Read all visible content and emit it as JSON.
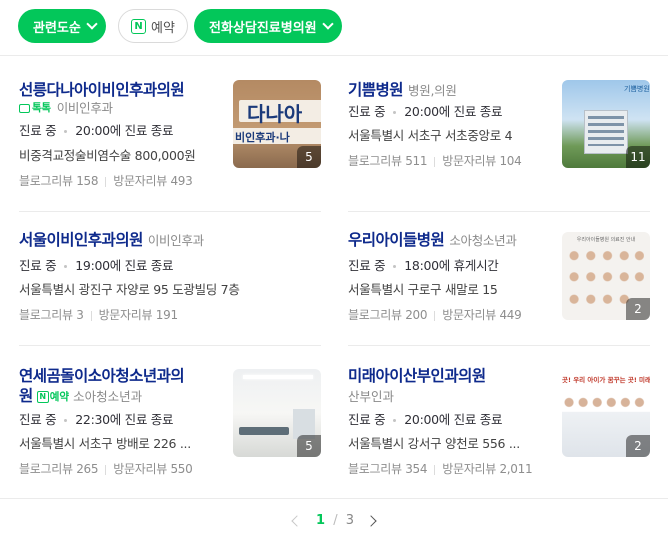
{
  "filters": {
    "related_label": "관련도순",
    "reserve_label": "예약",
    "phone_label": "전화상담진료병의원"
  },
  "places": [
    {
      "name": "선릉다나아이비인후과의원",
      "category": "이비인후과",
      "badge": "톡톡",
      "status": "진료 중",
      "hours": "20:00에 진료 종료",
      "extra": "비중격교정술비염수술 800,000원",
      "blog_label": "블로그리뷰",
      "blog_count": "158",
      "visit_label": "방문자리뷰",
      "visit_count": "493",
      "photo_count": "5",
      "photo_text": "다나아 | 비인후과·나"
    },
    {
      "name": "기쁨병원",
      "category": "병원,의원",
      "status": "진료 중",
      "hours": "20:00에 진료 종료",
      "extra": "서울특별시 서초구 서초중앙로 4",
      "blog_label": "블로그리뷰",
      "blog_count": "511",
      "visit_label": "방문자리뷰",
      "visit_count": "104",
      "photo_count": "11",
      "photo_text": "기쁨병원"
    },
    {
      "name": "서울이비인후과의원",
      "category": "이비인후과",
      "status": "진료 중",
      "hours": "19:00에 진료 종료",
      "extra": "서울특별시 광진구 자양로 95 도광빌딩 7층",
      "blog_label": "블로그리뷰",
      "blog_count": "3",
      "visit_label": "방문자리뷰",
      "visit_count": "191"
    },
    {
      "name": "우리아이들병원",
      "category": "소아청소년과",
      "status": "진료 중",
      "hours": "18:00에 휴게시간",
      "extra": "서울특별시 구로구 새말로 15",
      "blog_label": "블로그리뷰",
      "blog_count": "200",
      "visit_label": "방문자리뷰",
      "visit_count": "449",
      "photo_count": "2",
      "photo_text": "우리아이들병원 의료진 안내"
    },
    {
      "name": "연세곰돌이소아청소년과의원",
      "name_line1": "연세곰돌이소아청소년과의",
      "name_line2": "원",
      "badge": "예약",
      "category": "소아청소년과",
      "status": "진료 중",
      "hours": "22:30에 진료 종료",
      "extra": "서울특별시 서초구 방배로 226 ...",
      "blog_label": "블로그리뷰",
      "blog_count": "265",
      "visit_label": "방문자리뷰",
      "visit_count": "550",
      "photo_count": "5"
    },
    {
      "name": "미래아이산부인과의원",
      "category": "산부인과",
      "status": "진료 중",
      "hours": "20:00에 진료 종료",
      "extra": "서울특별시 강서구 양천로 556 ...",
      "blog_label": "블로그리뷰",
      "blog_count": "354",
      "visit_label": "방문자리뷰",
      "visit_count": "2,011",
      "photo_count": "2",
      "photo_text": "곳! 우리 아이가 꿈꾸는 곳! 미래아"
    }
  ],
  "pagination": {
    "current": "1",
    "separator": "/",
    "total": "3"
  },
  "colors": {
    "accent": "#03c75a",
    "title": "#0e2a8c"
  }
}
